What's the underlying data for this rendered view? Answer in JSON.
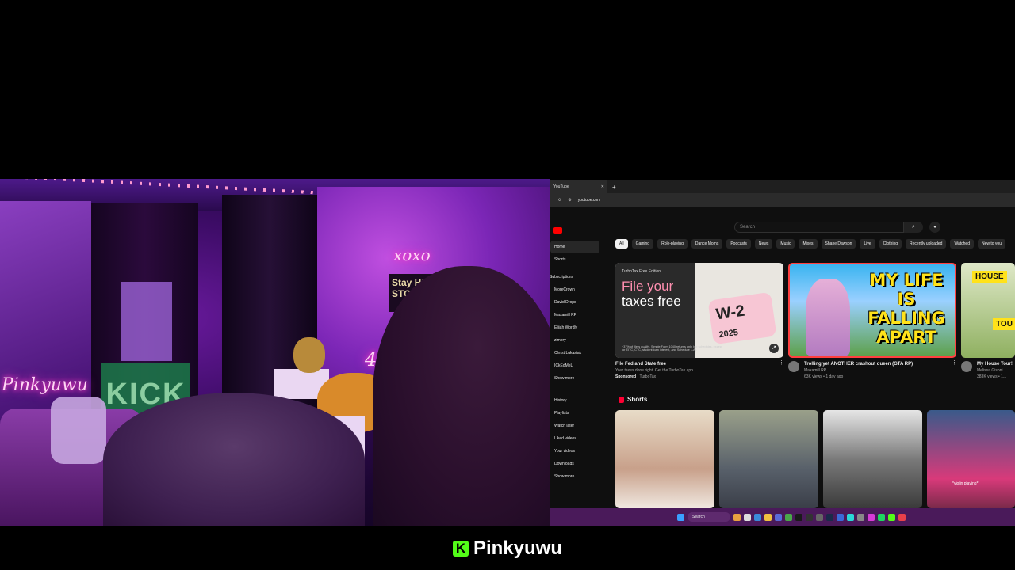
{
  "browser": {
    "tab_title": "YouTube",
    "url": "youtube.com"
  },
  "youtube": {
    "search_placeholder": "Search",
    "chips": [
      "All",
      "Gaming",
      "Role-playing",
      "Dance Moms",
      "Podcasts",
      "News",
      "Music",
      "Mixes",
      "Shane Dawson",
      "Live",
      "Clothing",
      "Recently uploaded",
      "Watched",
      "New to you"
    ],
    "sidebar": {
      "home": "Home",
      "shorts": "Shorts",
      "subscriptions": "Subscriptions",
      "channels": [
        "MoreCrown",
        "David Drops",
        "Maxamill RP",
        "Elijah Wordly",
        "zimery",
        "Christ Lukasiak",
        "ICkEdMeL"
      ],
      "show_more_1": "Show more",
      "you_items": [
        "History",
        "Playlists",
        "Watch later",
        "Liked videos",
        "Your videos",
        "Downloads"
      ],
      "show_more_2": "Show more"
    },
    "ad": {
      "edition": "TurboTax Free Edition",
      "headline_1": "File your",
      "headline_2": "taxes free",
      "w2": "W-2",
      "year": "2025",
      "fine_print": "~37% of filers qualify. Simple Form 1040 returns only (no schedules, except for EITC, CTC, student loan interest, and Schedule 1-A).",
      "title": "File Fed and State free",
      "desc": "Your taxes done right. Get the TurboTax app.",
      "sponsored": "Sponsored",
      "advertiser": "TurboTax"
    },
    "video1": {
      "thumb_text": "MY LIFE IS FALLING APART",
      "title": "Trolling yet ANOTHER crashout queen (GTA RP)",
      "channel": "Maxamill RP",
      "stats": "63K views • 1 day ago"
    },
    "video2": {
      "thumb_text_1": "HOUSE",
      "thumb_text_2": "TOU",
      "title": "My House Tour!",
      "channel": "Melissa Gisoni",
      "stats": "383K views • 1..."
    },
    "shorts_heading": "Shorts",
    "short4_caption": "*violin playing*"
  },
  "taskbar": {
    "search": "Search"
  },
  "stream": {
    "room_sign_xoxo": "xoxo",
    "room_sign_kick": "KICK",
    "room_sign_name": "Pinkyuwu",
    "room_sign_42": "42",
    "room_sign_stoner": "Stay Hi... STONER",
    "brand_name": "Pinkyuwu",
    "brand_logo": "K"
  },
  "colors": {
    "kick_green": "#53fc18",
    "youtube_red": "#ff0000",
    "taskbar": "#4a1a5a"
  }
}
